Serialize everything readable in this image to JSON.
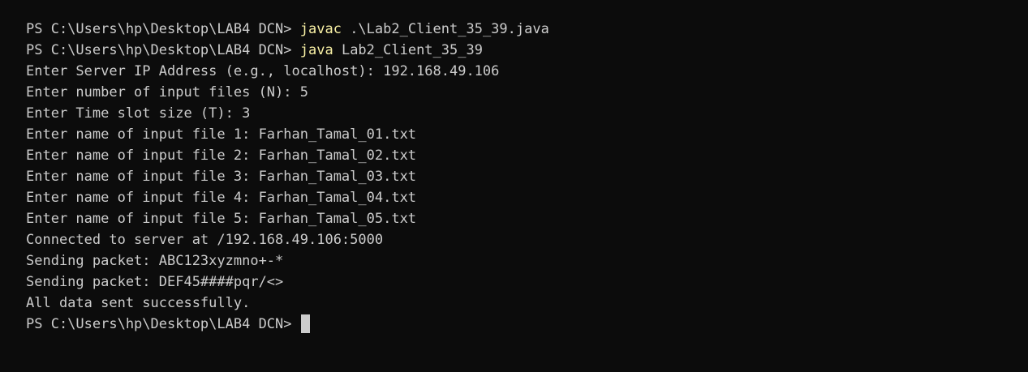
{
  "terminal": {
    "colors": {
      "background": "#0c0c0c",
      "foreground": "#cccccc",
      "command": "#f9f1a5"
    },
    "lines": [
      {
        "prompt": "PS C:\\Users\\hp\\Desktop\\LAB4 DCN> ",
        "command": "javac",
        "args": " .\\Lab2_Client_35_39.java"
      },
      {
        "prompt": "PS C:\\Users\\hp\\Desktop\\LAB4 DCN> ",
        "command": "java",
        "args": " Lab2_Client_35_39"
      },
      {
        "text": "Enter Server IP Address (e.g., localhost): 192.168.49.106"
      },
      {
        "text": "Enter number of input files (N): 5"
      },
      {
        "text": "Enter Time slot size (T): 3"
      },
      {
        "text": "Enter name of input file 1: Farhan_Tamal_01.txt"
      },
      {
        "text": "Enter name of input file 2: Farhan_Tamal_02.txt"
      },
      {
        "text": "Enter name of input file 3: Farhan_Tamal_03.txt"
      },
      {
        "text": "Enter name of input file 4: Farhan_Tamal_04.txt"
      },
      {
        "text": "Enter name of input file 5: Farhan_Tamal_05.txt"
      },
      {
        "text": "Connected to server at /192.168.49.106:5000"
      },
      {
        "text": "Sending packet: ABC123xyzmno+-*"
      },
      {
        "text": "Sending packet: DEF45####pqr/<>"
      },
      {
        "text": "All data sent successfully."
      },
      {
        "prompt": "PS C:\\Users\\hp\\Desktop\\LAB4 DCN> ",
        "cursor": true
      }
    ]
  }
}
